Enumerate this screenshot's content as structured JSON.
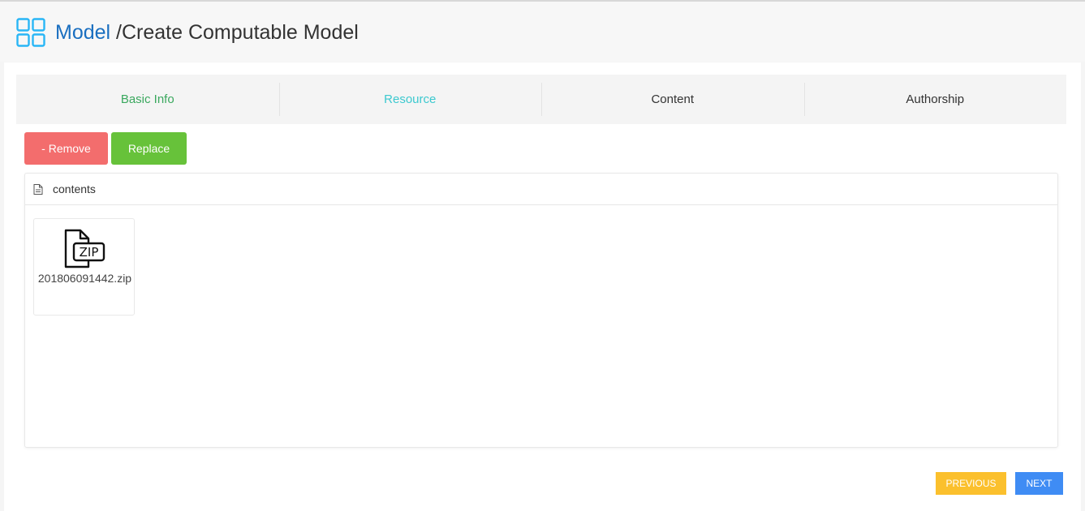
{
  "header": {
    "icon": "grid-icon",
    "model_link": "Model",
    "path": "/Create Computable Model"
  },
  "steps": [
    {
      "label": "Basic Info",
      "state": "done"
    },
    {
      "label": "Resource",
      "state": "active"
    },
    {
      "label": "Content",
      "state": "pending"
    },
    {
      "label": "Authorship",
      "state": "pending"
    }
  ],
  "actions": {
    "remove_label": "- Remove",
    "replace_label": "Replace"
  },
  "browser": {
    "folder_icon": "document-icon",
    "folder_label": "contents",
    "files": [
      {
        "icon": "zip-file-icon",
        "icon_text": "ZIP",
        "name": "201806091442.zip"
      }
    ]
  },
  "nav": {
    "previous_label": "PREVIOUS",
    "next_label": "NEXT"
  },
  "colors": {
    "model_link": "#1a6fc0",
    "step_done": "#3aa85e",
    "step_active": "#3cc9cf",
    "remove": "#f36d6d",
    "replace": "#67c23a",
    "previous": "#fbc02d",
    "next": "#3f8cf4",
    "icon": "#29b6f6"
  }
}
